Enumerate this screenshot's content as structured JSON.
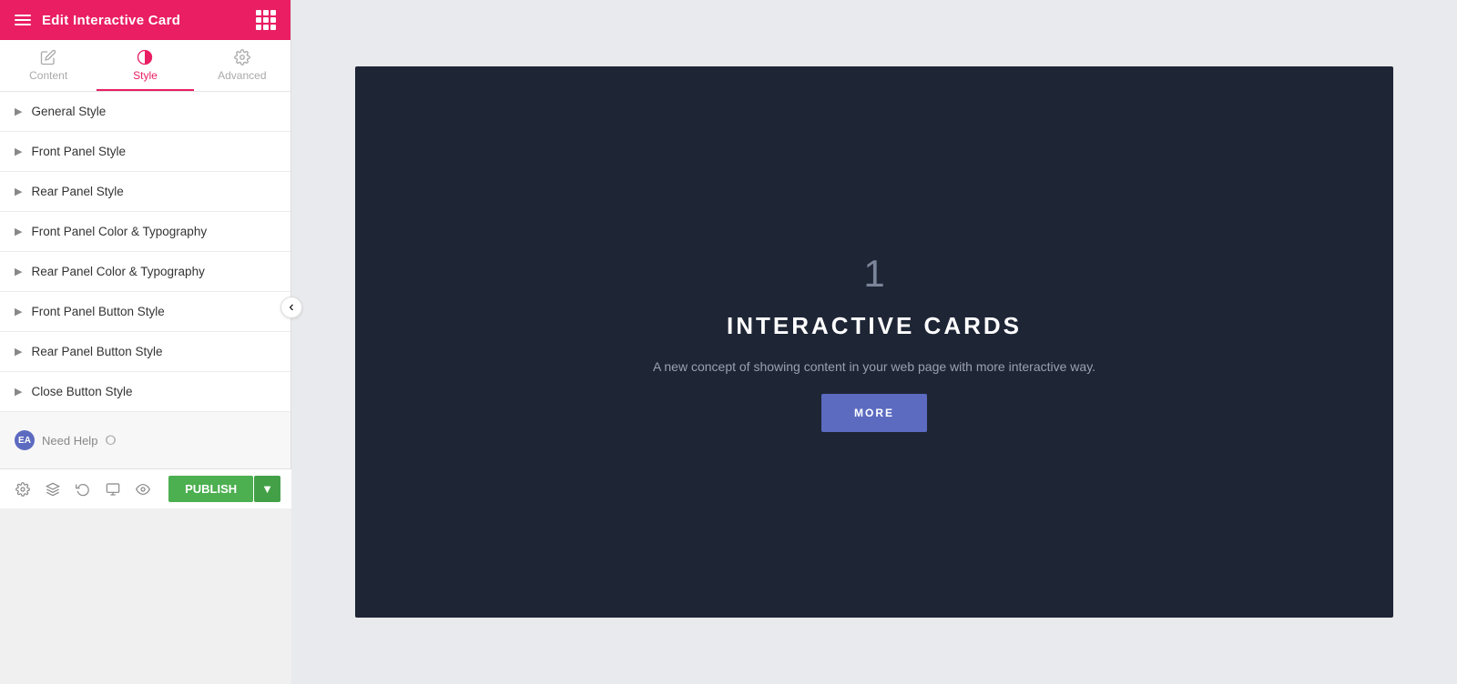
{
  "header": {
    "title": "Edit Interactive Card",
    "hamburger_label": "menu",
    "grid_label": "grid"
  },
  "tabs": [
    {
      "id": "content",
      "label": "Content",
      "icon": "pencil"
    },
    {
      "id": "style",
      "label": "Style",
      "icon": "circle-half",
      "active": true
    },
    {
      "id": "advanced",
      "label": "Advanced",
      "icon": "gear"
    }
  ],
  "sections": [
    {
      "id": "general-style",
      "label": "General Style"
    },
    {
      "id": "front-panel-style",
      "label": "Front Panel Style"
    },
    {
      "id": "rear-panel-style",
      "label": "Rear Panel Style"
    },
    {
      "id": "front-panel-color-typography",
      "label": "Front Panel Color & Typography"
    },
    {
      "id": "rear-panel-color-typography",
      "label": "Rear Panel Color & Typography"
    },
    {
      "id": "front-panel-button-style",
      "label": "Front Panel Button Style"
    },
    {
      "id": "rear-panel-button-style",
      "label": "Rear Panel Button Style"
    },
    {
      "id": "close-button-style",
      "label": "Close Button Style"
    }
  ],
  "need_help": {
    "badge": "EA",
    "label": "Need Help",
    "help_icon": "?"
  },
  "card": {
    "number": "1",
    "title": "INTERACTIVE CARDS",
    "description": "A new concept of showing content in your web page with more interactive way.",
    "button_label": "MORE"
  },
  "toolbar": {
    "publish_label": "PUBLISH",
    "icons": [
      "settings",
      "layers",
      "history",
      "monitor",
      "eye"
    ]
  },
  "colors": {
    "header_bg": "#e91e63",
    "card_bg": "#1e2535",
    "card_number": "#7b8599",
    "card_title": "#ffffff",
    "card_desc": "#9aa0b0",
    "card_btn": "#5c6bc0",
    "publish_btn": "#4caf50",
    "active_tab": "#e91e63"
  }
}
